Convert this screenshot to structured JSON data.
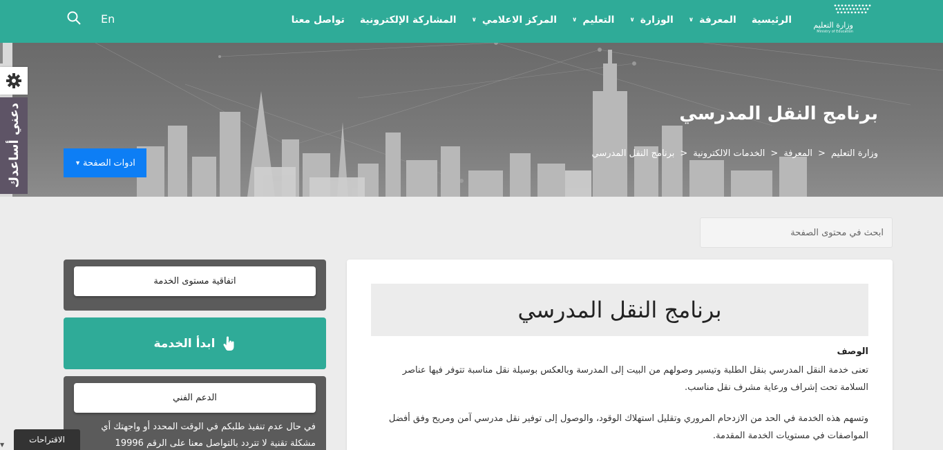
{
  "header": {
    "logo_ar": "وزارة التعليم",
    "logo_en": "Ministry of Education",
    "nav": [
      {
        "label": "الرئيسية",
        "has_dropdown": false
      },
      {
        "label": "المعرفة",
        "has_dropdown": true
      },
      {
        "label": "الوزارة",
        "has_dropdown": true
      },
      {
        "label": "التعليم",
        "has_dropdown": true
      },
      {
        "label": "المركز الاعلامي",
        "has_dropdown": true
      },
      {
        "label": "المشاركة الإلكترونية",
        "has_dropdown": false
      },
      {
        "label": "تواصل معنا",
        "has_dropdown": false
      }
    ],
    "lang": "En",
    "search_icon": "search-icon"
  },
  "hero": {
    "title": "برنامج النقل المدرسي",
    "breadcrumb": [
      "وزارة التعليم",
      ">",
      "المعرفة",
      ">",
      "الخدمات الالكترونية",
      ">",
      "برنامج النقل المدرسي"
    ],
    "tools_label": "ادوات الصفحة"
  },
  "helper": {
    "label": "دعني أساعدك",
    "icon": "gear-icon"
  },
  "search": {
    "placeholder": "ابحث في محتوى الصفحة"
  },
  "main": {
    "title": "برنامج النقل المدرسي",
    "desc_heading": "الوصف",
    "desc_p1": "تعنى خدمة النقل المدرسي بنقل الطلبة وتيسير وصولهم من البيت إلى المدرسة وبالعكس بوسيلة نقل مناسبة تتوفر فيها عناصر السلامة تحت إشراف ورعاية مشرف نقل مناسب.",
    "desc_p2": "وتسهم هذه الخدمة في الحد من الازدحام المروري وتقليل استهلاك الوقود، والوصول إلى توفير نقل مدرسي آمن ومريح وفق أفضل المواصفات في مستويات الخدمة المقدمة."
  },
  "sidebar": {
    "sla_label": "اتفاقية مستوى الخدمة",
    "start_label": "ابدأ الخدمة",
    "support_label": "الدعم الفني",
    "support_text": "في حال عدم تنفيذ طلبكم في الوقت المحدد أو واجهتك أي مشكلة تقنية لا تتردد بالتواصل معنا على الرقم 19996"
  },
  "feedback_label": "الاقتراحات",
  "colors": {
    "primary": "#2fab98",
    "blue": "#0d7ef5",
    "dark": "#5b5b5b",
    "helper": "#5e5466"
  }
}
